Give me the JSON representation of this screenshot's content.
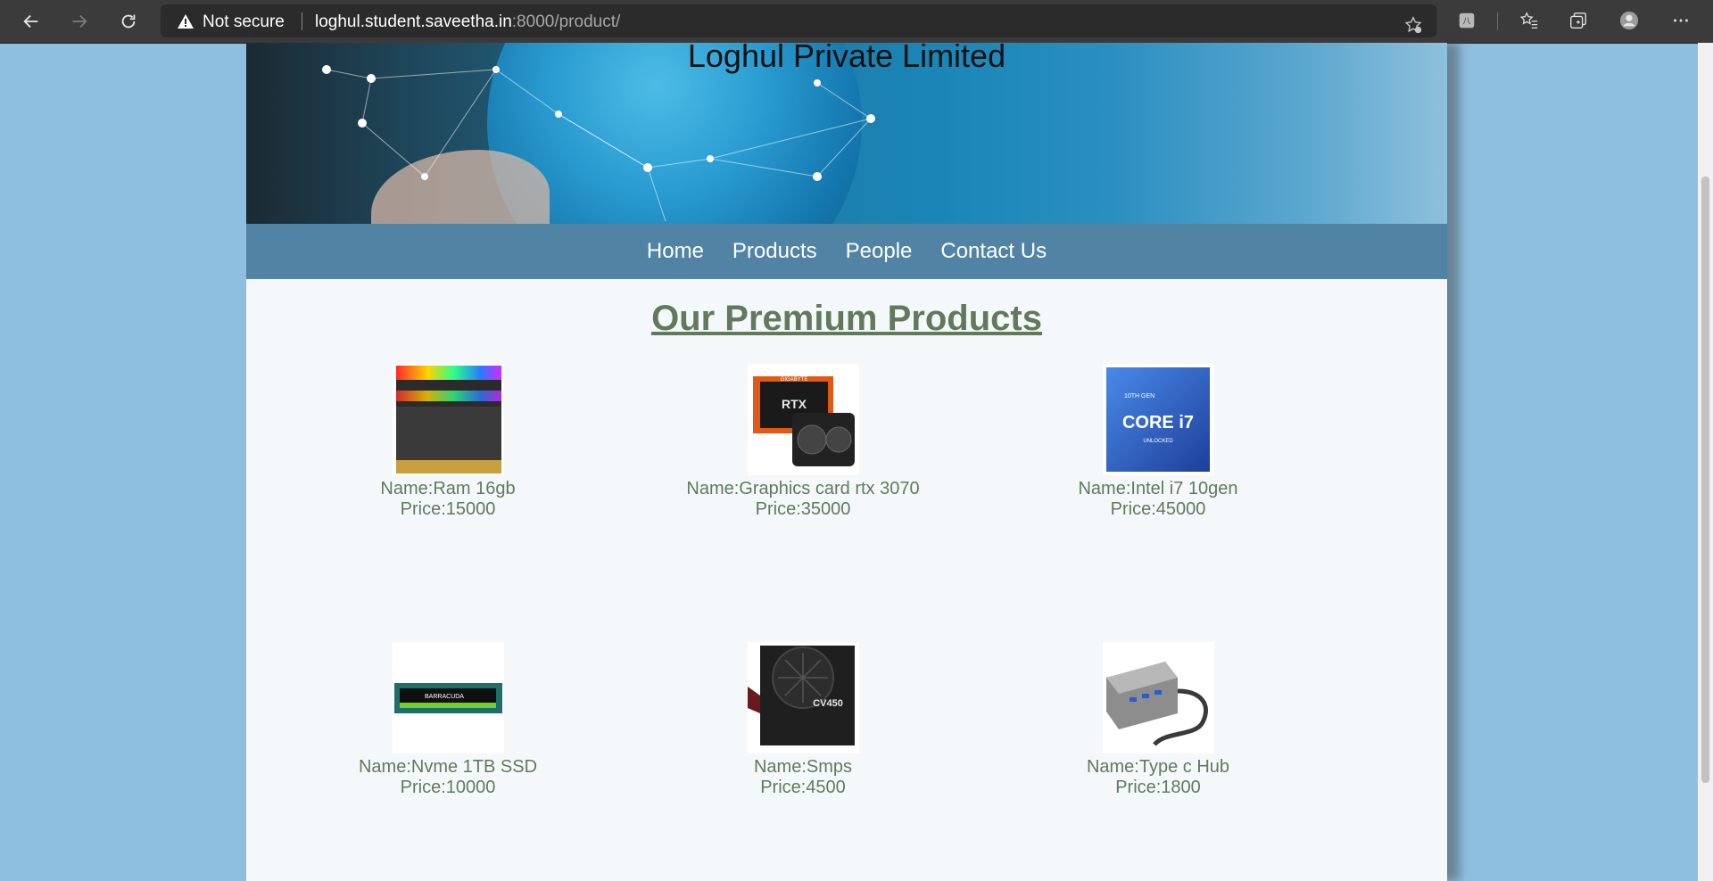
{
  "browser": {
    "security_label": "Not secure",
    "url_host": "loghul.student.saveetha.in",
    "url_rest": ":8000/product/",
    "icons": [
      "back-icon",
      "forward-icon",
      "reload-icon",
      "warning-icon",
      "add-favorite-icon",
      "extension-icon",
      "favorites-icon",
      "collections-icon",
      "profile-icon",
      "more-icon"
    ]
  },
  "site": {
    "company_name": "Loghul Private Limited",
    "nav": [
      "Home",
      "Products",
      "People",
      "Contact Us"
    ],
    "heading": "Our Premium Products"
  },
  "products": [
    {
      "name": "Name:Ram 16gb",
      "price": "Price:15000"
    },
    {
      "name": "Name:Graphics card rtx 3070",
      "price": "Price:35000"
    },
    {
      "name": "Name:Intel i7 10gen",
      "price": "Price:45000"
    },
    {
      "name": "Name:Nvme 1TB SSD",
      "price": "Price:10000"
    },
    {
      "name": "Name:Smps",
      "price": "Price:4500"
    },
    {
      "name": "Name:Type c Hub",
      "price": "Price:1800"
    }
  ],
  "image_labels": {
    "gpu_brand": "GIGABYTE",
    "gpu_model": "RTX",
    "cpu_gen": "10TH GEN",
    "cpu_name": "CORE i7",
    "cpu_tag": "UNLOCKED",
    "ssd_brand": "BARRACUDA",
    "psu_model": "CV450"
  }
}
